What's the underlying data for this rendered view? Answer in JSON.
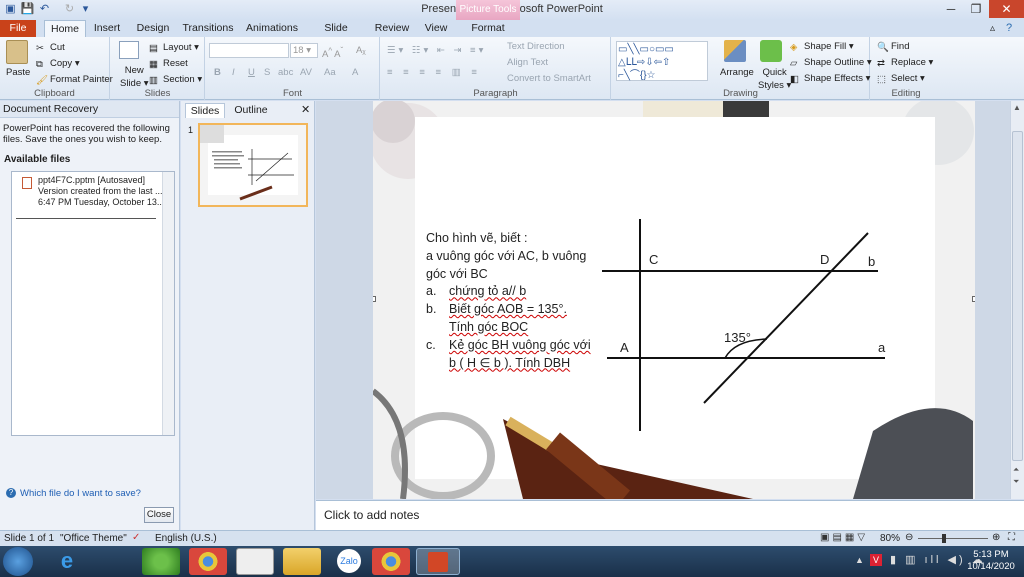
{
  "window": {
    "title": "Presentation1 - Microsoft PowerPoint",
    "context_tab": "Picture Tools"
  },
  "tabs": [
    "File",
    "Home",
    "Insert",
    "Design",
    "Transitions",
    "Animations",
    "Slide Show",
    "Review",
    "View",
    "Format"
  ],
  "ribbon": {
    "clipboard": {
      "label": "Clipboard",
      "paste": "Paste",
      "cut": "Cut",
      "copy": "Copy",
      "format_painter": "Format Painter"
    },
    "slides": {
      "label": "Slides",
      "new_slide": "New",
      "new_slide2": "Slide",
      "layout": "Layout",
      "reset": "Reset",
      "section": "Section"
    },
    "font": {
      "label": "Font",
      "size": "18",
      "bold": "B",
      "italic": "I",
      "underline": "U",
      "strike": "S",
      "shadow": "abc",
      "spacing": "AV",
      "case": "Aa",
      "color": "A"
    },
    "paragraph": {
      "label": "Paragraph",
      "text_direction": "Text Direction",
      "align_text": "Align Text",
      "convert": "Convert to SmartArt"
    },
    "drawing": {
      "label": "Drawing",
      "arrange": "Arrange",
      "quick_styles": "Quick",
      "quick_styles2": "Styles",
      "shape_fill": "Shape Fill",
      "shape_outline": "Shape Outline",
      "shape_effects": "Shape Effects"
    },
    "editing": {
      "label": "Editing",
      "find": "Find",
      "replace": "Replace",
      "select": "Select"
    }
  },
  "recovery": {
    "header": "Document Recovery",
    "message": "PowerPoint has recovered the following files. Save the ones you wish to keep.",
    "available": "Available files",
    "file_name": "ppt4F7C.pptm  [Autosaved]",
    "file_line2": "Version created from the last ...",
    "file_line3": "6:47 PM Tuesday, October 13...",
    "help_link": "Which file do I want to save?",
    "close": "Close"
  },
  "slides_pane": {
    "tab_slides": "Slides",
    "tab_outline": "Outline",
    "slide_number": "1"
  },
  "slide": {
    "intro": "Cho hình vẽ, biết :",
    "line1": "a vuông góc với AC, b vuông góc với BC",
    "item_a_marker": "a.",
    "item_a": "chứng tỏ a// b",
    "item_b_marker": "b.",
    "item_b1": "Biết góc AOB = 135°.",
    "item_b2": "Tính góc BOC",
    "item_c_marker": "c.",
    "item_c1": "Kẻ góc BH vuông góc với",
    "item_c2": "b ( H ∈ b ). Tính DBH",
    "label_C": "C",
    "label_D": "D",
    "label_b": "b",
    "label_A": "A",
    "label_a": "a",
    "label_angle": "135°"
  },
  "notes_placeholder": "Click to add notes",
  "status": {
    "slide": "Slide 1 of 1",
    "theme": "\"Office Theme\"",
    "language": "English (U.S.)",
    "zoom": "80%"
  },
  "taskbar": {
    "time": "5:13 PM",
    "date": "10/14/2020",
    "zalo": "Zalo"
  }
}
